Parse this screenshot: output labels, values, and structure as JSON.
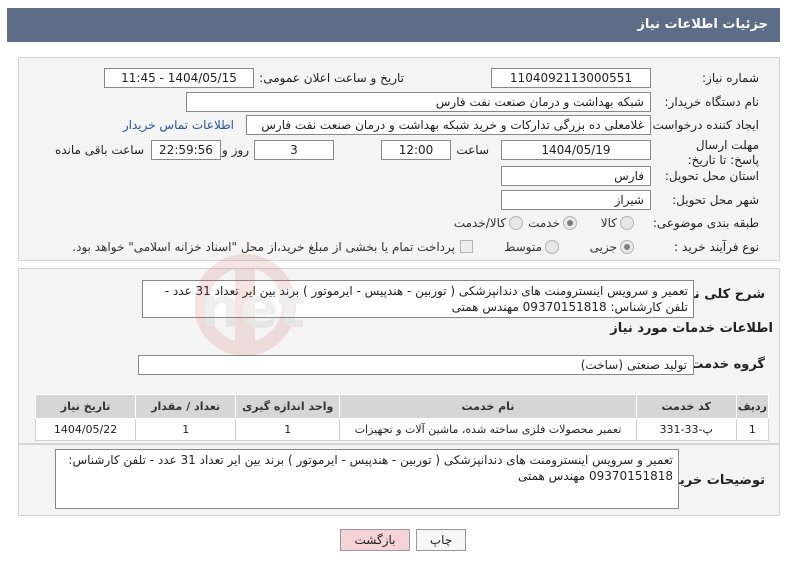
{
  "header": {
    "title": "جزئیات اطلاعات نیاز"
  },
  "fields": {
    "need_number": {
      "label": "شماره نیاز:",
      "value": "1104092113000551"
    },
    "announce": {
      "label": "تاریخ و ساعت اعلان عمومی:",
      "value": "1404/05/15 - 11:45"
    },
    "buyer": {
      "label": "نام دستگاه خریدار:",
      "value": "شبکه بهداشت و درمان صنعت نفت فارس"
    },
    "creator": {
      "label": "ایجاد کننده درخواست:",
      "value": "غلامعلی ده بزرگی تدارکات و خرید شبکه بهداشت و درمان صنعت نفت فارس",
      "contact_link": "اطلاعات تماس خریدار"
    },
    "deadline": {
      "label": "مهلت ارسال پاسخ: تا تاریخ:",
      "date": "1404/05/19",
      "time_label": "ساعت",
      "time": "12:00",
      "days": "3",
      "days_label": "روز و",
      "remaining": "22:59:56",
      "remaining_label": "ساعت باقی مانده"
    },
    "province": {
      "label": "استان محل تحویل:",
      "value": "فارس"
    },
    "city": {
      "label": "شهر محل تحویل:",
      "value": "شیراز"
    },
    "category": {
      "label": "طبقه بندی موضوعی:",
      "options": [
        "کالا",
        "خدمت",
        "کالا/خدمت"
      ],
      "selected": "خدمت"
    },
    "process": {
      "label": "نوع فرآیند خرید :",
      "options": [
        "جزیی",
        "متوسط"
      ],
      "selected": "جزیی",
      "payment_note": "پرداخت تمام یا بخشی از مبلغ خرید،از محل \"اسناد خزانه اسلامی\" خواهد بود."
    }
  },
  "summary": {
    "label": "شرح کلی نیاز:",
    "text": "تعمیر و سرویس اینسترومنت های دندانپزشکی ( توربین - هندپیس - ایرموتور ) برند بین ایر تعداد 31 عدد - تلفن کارشناس: 09370151818 مهندس همتی"
  },
  "services": {
    "heading": "اطلاعات خدمات مورد نیاز",
    "group_label": "گروه خدمت:",
    "group_value": "تولید صنعتی (ساخت)",
    "columns": [
      "ردیف",
      "کد خدمت",
      "نام خدمت",
      "واحد اندازه گیری",
      "تعداد / مقدار",
      "تاریخ نیاز"
    ],
    "rows": [
      [
        "1",
        "پ-33-331",
        "تعمیر محصولات فلزی ساخته شده، ماشین آلات و تجهیزات",
        "1",
        "1",
        "1404/05/22"
      ]
    ]
  },
  "buyer_notes": {
    "label": "توضیحات خریدار:",
    "text": "تعمیر و سرویس اینسترومنت های دندانپزشکی ( توربین - هندپیس - ایرموتور ) برند بین ایر تعداد 31 عدد - تلفن کارشناس: 09370151818 مهندس همتی"
  },
  "buttons": {
    "print": "چاپ",
    "back": "بازگشت"
  },
  "watermark": {
    "text": "AriaTender.net"
  },
  "colors": {
    "header_bg": "#5d6d87",
    "link": "#2a56a0",
    "back_btn": "#f6d3d7"
  }
}
